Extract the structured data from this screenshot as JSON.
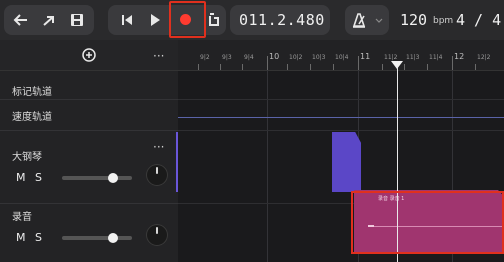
{
  "toolbar": {
    "time": "011.2.480",
    "bpm": "120",
    "bpm_unit": "bpm",
    "time_signature": "4 / 4",
    "metronome_icon": "metronome-icon",
    "record_color": "#ff3b30",
    "highlight_color": "#e0301e"
  },
  "left_panel": {
    "add_icon": "plus-circle-icon",
    "menu": "···",
    "rows": {
      "markers": "标记轨道",
      "tempo": "速度轨道"
    },
    "tracks": [
      {
        "name": "大钢琴",
        "mute": "M",
        "solo": "S",
        "menu": "···",
        "volume_fraction": 0.75
      },
      {
        "name": "录音",
        "mute": "M",
        "solo": "S",
        "volume_fraction": 0.75
      }
    ]
  },
  "ruler": {
    "labels": [
      "9|2",
      "9|3",
      "9|4",
      "10",
      "10|2",
      "10|3",
      "10|4",
      "11",
      "11|2",
      "11|3",
      "11|4",
      "12",
      "12|2"
    ]
  },
  "clips": {
    "recording_label": "录音 录音 1",
    "piano_color": "#5b47c7",
    "recording_color": "#a0356f"
  }
}
